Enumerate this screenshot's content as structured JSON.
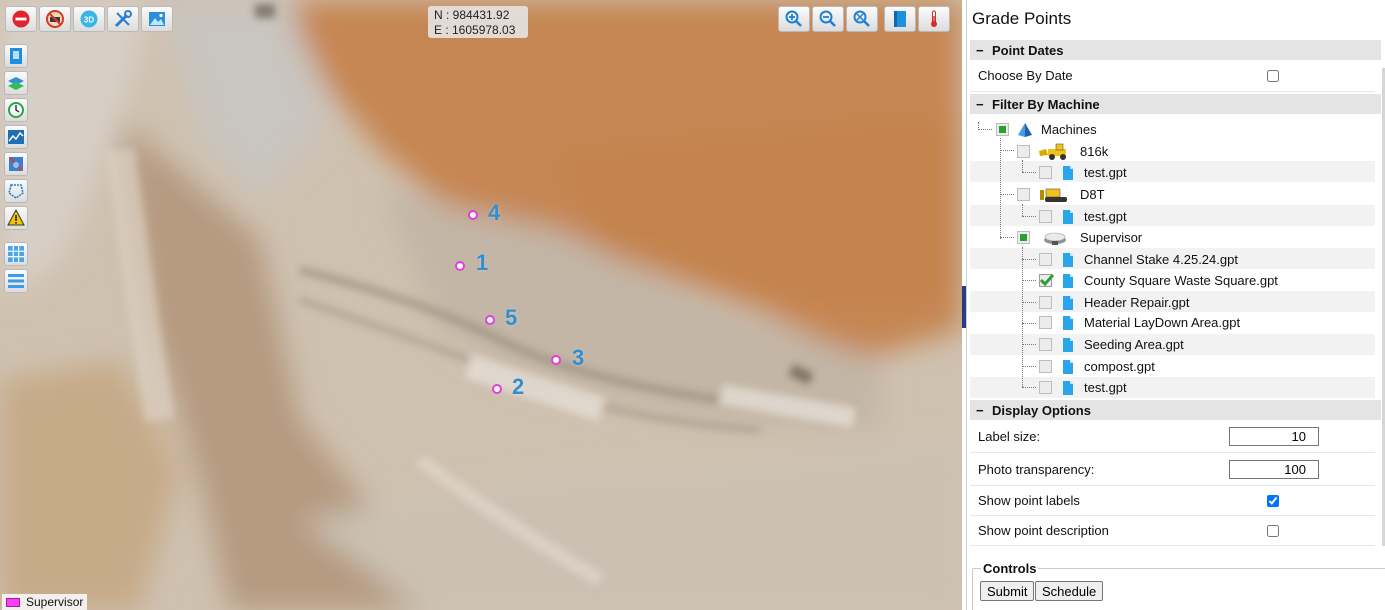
{
  "map": {
    "coords": {
      "north": "N : 984431.92",
      "east": "E : 1605978.03"
    },
    "toolbar_left": [
      {
        "name": "stop-icon"
      },
      {
        "name": "machine-off-icon"
      },
      {
        "name": "3d-icon",
        "label": "3D"
      },
      {
        "name": "tools-icon"
      },
      {
        "name": "image-icon"
      }
    ],
    "toolbar_right": [
      {
        "name": "zoom-in-icon"
      },
      {
        "name": "zoom-out-icon"
      },
      {
        "name": "zoom-extent-icon"
      },
      {
        "name": "book-icon"
      },
      {
        "name": "thermometer-icon"
      }
    ],
    "side_tools": [
      {
        "name": "panel-toggle-icon"
      },
      {
        "name": "layers-icon"
      },
      {
        "name": "history-clock-icon"
      },
      {
        "name": "chart-icon"
      },
      {
        "name": "machine-tool-icon"
      },
      {
        "name": "polygon-icon"
      },
      {
        "name": "warning-icon"
      },
      {
        "name": "grid-icon"
      },
      {
        "name": "list-icon"
      }
    ],
    "points": [
      {
        "label": "4"
      },
      {
        "label": "1"
      },
      {
        "label": "5"
      },
      {
        "label": "3"
      },
      {
        "label": "2"
      }
    ],
    "legend": {
      "label": "Supervisor",
      "color": "#ff3df7"
    }
  },
  "panel": {
    "title": "Grade Points",
    "point_dates": {
      "header": "Point Dates",
      "choose_by_date": {
        "label": "Choose By Date",
        "checked": false
      }
    },
    "filter_by_machine": {
      "header": "Filter By Machine",
      "root": "Machines",
      "machines": [
        {
          "name": "816k",
          "files": [
            "test.gpt"
          ]
        },
        {
          "name": "D8T",
          "files": [
            "test.gpt"
          ]
        },
        {
          "name": "Supervisor",
          "files": [
            "Channel Stake 4.25.24.gpt",
            "County Square Waste Square.gpt",
            "Header Repair.gpt",
            "Material LayDown Area.gpt",
            "Seeding Area.gpt",
            "compost.gpt",
            "test.gpt"
          ]
        }
      ]
    },
    "display_options": {
      "header": "Display Options",
      "label_size": {
        "label": "Label size:",
        "value": "10"
      },
      "photo_transparency": {
        "label": "Photo transparency:",
        "value": "100"
      },
      "show_point_labels": {
        "label": "Show point labels",
        "checked": true
      },
      "show_point_description": {
        "label": "Show point description",
        "checked": false
      }
    },
    "controls": {
      "legend": "Controls",
      "submit": "Submit",
      "schedule": "Schedule"
    }
  }
}
